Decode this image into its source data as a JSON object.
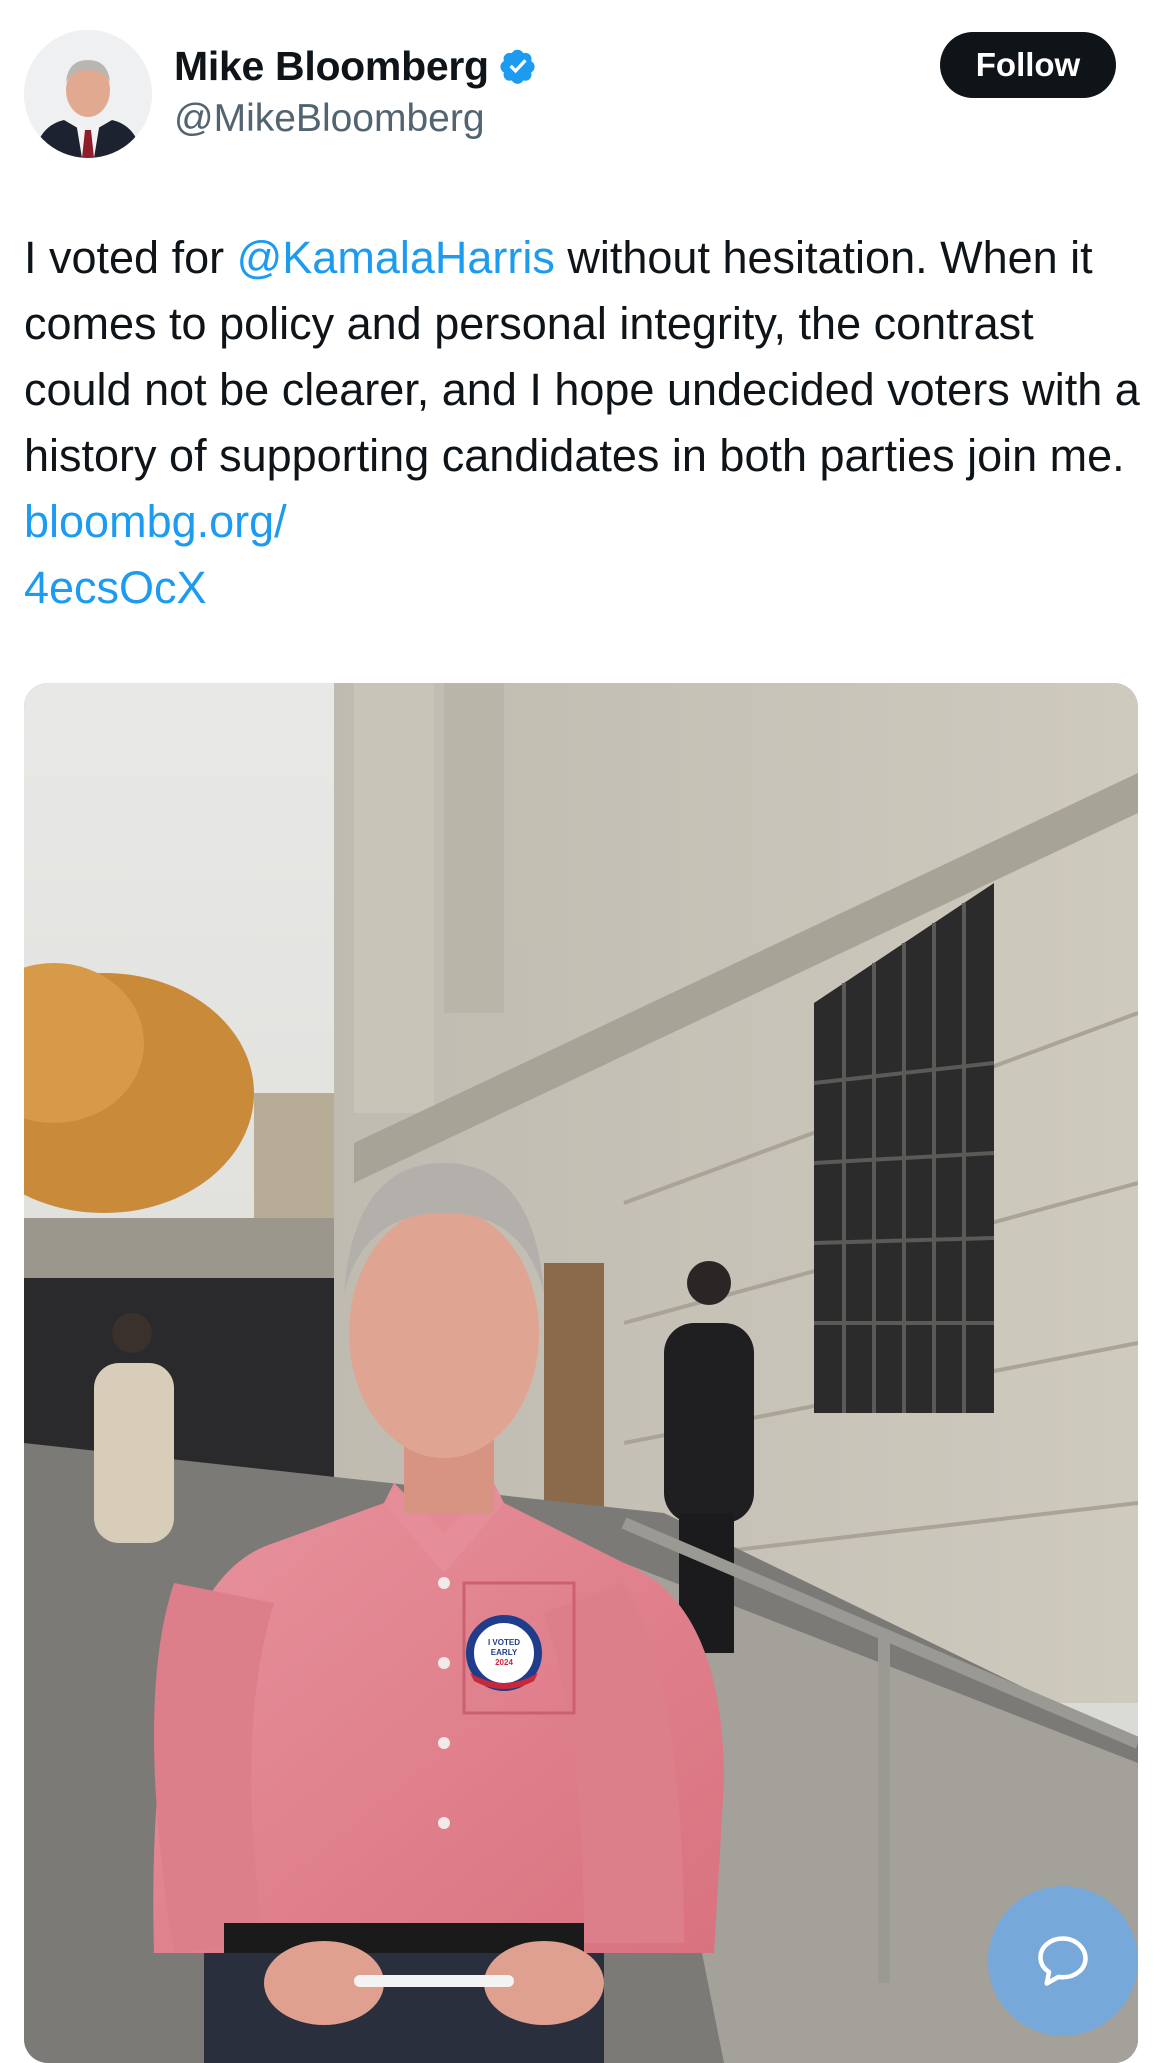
{
  "author": {
    "display_name": "Mike Bloomberg",
    "handle": "@MikeBloomberg",
    "verified": true
  },
  "follow_label": "Follow",
  "tweet": {
    "part1": "I voted for ",
    "mention": "@KamalaHarris",
    "part2": " without hesitation. When it comes to policy and personal integrity, the contrast could not be clearer, and I hope undecided voters with a history of supporting candidates in both parties join me. ",
    "link_line1": "bloombg.org/",
    "link_line2": "4ecsOcX"
  },
  "photo": {
    "sticker_line1": "I VOTED",
    "sticker_line2": "EARLY",
    "sticker_line3": "2024"
  },
  "colors": {
    "link": "#1d9bf0",
    "follow_bg": "#0f1419",
    "verified": "#1d9bf0"
  }
}
